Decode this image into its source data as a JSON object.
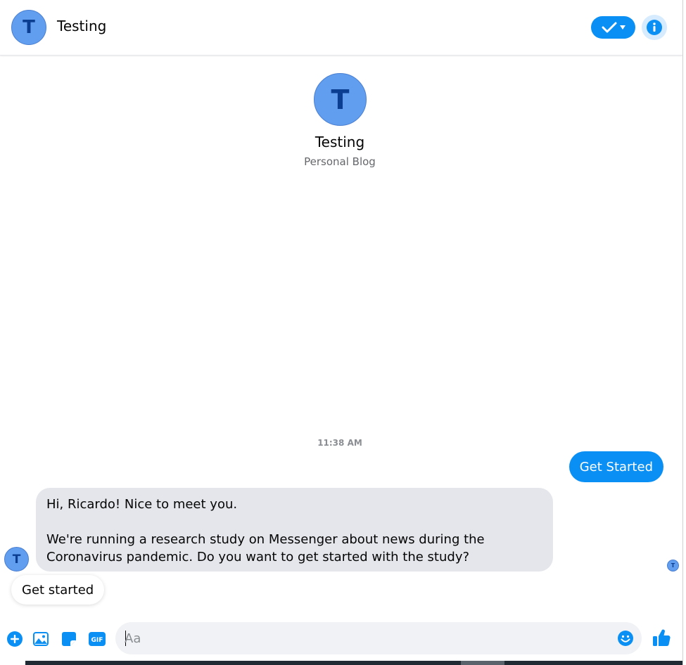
{
  "header": {
    "avatar_letter": "T",
    "title": "Testing"
  },
  "profile": {
    "avatar_letter": "T",
    "name": "Testing",
    "subtitle": "Personal Blog"
  },
  "conversation": {
    "timestamp": "11:38 AM",
    "outgoing_message": "Get Started",
    "incoming_avatar_letter": "T",
    "incoming_message": "Hi, Ricardo! Nice to meet you.\n\nWe're running a research study on Messenger about news during the Coronavirus pandemic. Do you want to get started with the study?",
    "seen_avatar_letter": "T",
    "quick_reply": "Get started"
  },
  "composer": {
    "placeholder": "Aa",
    "icons": [
      "plus-circle-icon",
      "photo-icon",
      "sticker-icon",
      "gif-icon",
      "emoji-icon",
      "thumbs-up-icon"
    ]
  },
  "colors": {
    "accent": "#0a90f5",
    "avatar": "#629ef0",
    "incoming_bubble": "#e4e6eb"
  }
}
